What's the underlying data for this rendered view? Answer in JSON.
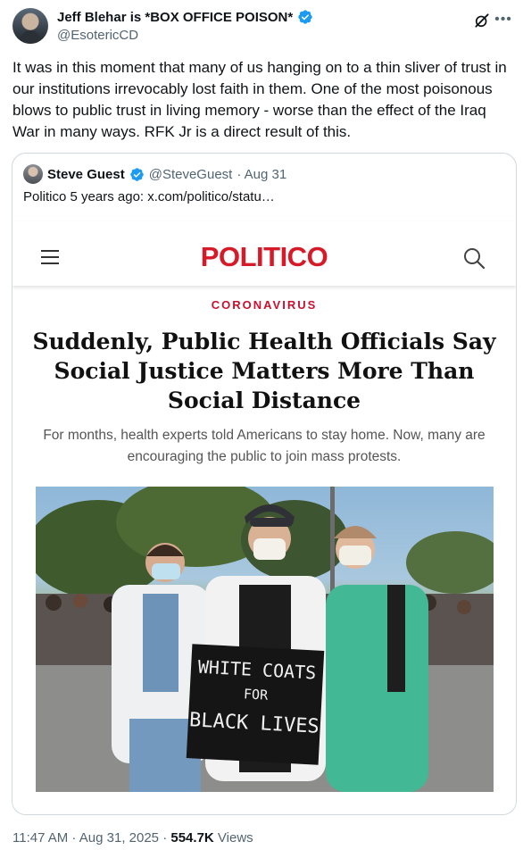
{
  "tweet": {
    "author": {
      "display_name": "Jeff Blehar is *BOX OFFICE POISON*",
      "handle": "@EsotericCD",
      "verified": true
    },
    "text": "It was in this moment that many of us hanging on to a thin sliver of trust in our institutions irrevocably lost faith in them. One of the most poisonous blows to public trust in living memory - worse than the effect of the Iraq War in many ways. RFK Jr is a direct result of this.",
    "time": "11:47 AM",
    "sep1": " · ",
    "date": "Aug 31, 2025",
    "sep2": " · ",
    "views_count": "554.7K",
    "views_label": " Views"
  },
  "quote": {
    "author": {
      "display_name": "Steve Guest",
      "handle": "@SteveGuest",
      "date": "· Aug 31",
      "verified": true
    },
    "text": "Politico 5 years ago:  x.com/politico/statu…"
  },
  "article": {
    "logo": "POLITICO",
    "kicker": "CORONAVIRUS",
    "headline": "Suddenly, Public Health Officials Say Social Justice Matters More Than Social Distance",
    "dek": "For months, health experts told Americans to stay home. Now, many are encouraging the public to join mass protests.",
    "photo_sign": [
      "WHITE COATS",
      "FOR",
      "BLACK LIVES"
    ]
  },
  "colors": {
    "verified_blue": "#1d9bf0",
    "politico_red": "#d61a28",
    "text_secondary": "#536471"
  },
  "icons": {
    "verified": "verified-badge-icon",
    "grok": "grok-icon",
    "more": "more-icon",
    "menu": "hamburger-menu-icon",
    "search": "search-icon"
  }
}
